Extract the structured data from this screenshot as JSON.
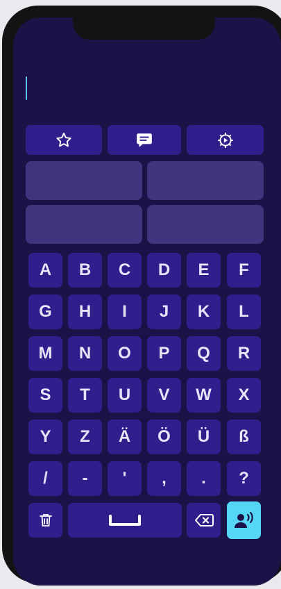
{
  "text_input": {
    "value": ""
  },
  "toolbar": [
    {
      "name": "favorites-button",
      "icon": "star-icon"
    },
    {
      "name": "phrases-button",
      "icon": "chat-icon"
    },
    {
      "name": "settings-button",
      "icon": "gear-icon"
    }
  ],
  "suggestions": [
    "",
    "",
    "",
    ""
  ],
  "keys": [
    [
      "A",
      "B",
      "C",
      "D",
      "E",
      "F"
    ],
    [
      "G",
      "H",
      "I",
      "J",
      "K",
      "L"
    ],
    [
      "M",
      "N",
      "O",
      "P",
      "Q",
      "R"
    ],
    [
      "S",
      "T",
      "U",
      "V",
      "W",
      "X"
    ],
    [
      "Y",
      "Z",
      "Ä",
      "Ö",
      "Ü",
      "ß"
    ],
    [
      "/",
      "-",
      "'",
      ",",
      ".",
      "?"
    ]
  ],
  "bottom_row": {
    "delete_all_icon": "trash-icon",
    "space_icon": "space-bar-icon",
    "backspace_icon": "backspace-icon",
    "speak_icon": "speaking-head-icon"
  },
  "colors": {
    "background": "#1b1247",
    "key": "#2e1f8c",
    "suggestion": "#3f357f",
    "accent": "#55d6f4",
    "text": "#e6e4f7"
  }
}
